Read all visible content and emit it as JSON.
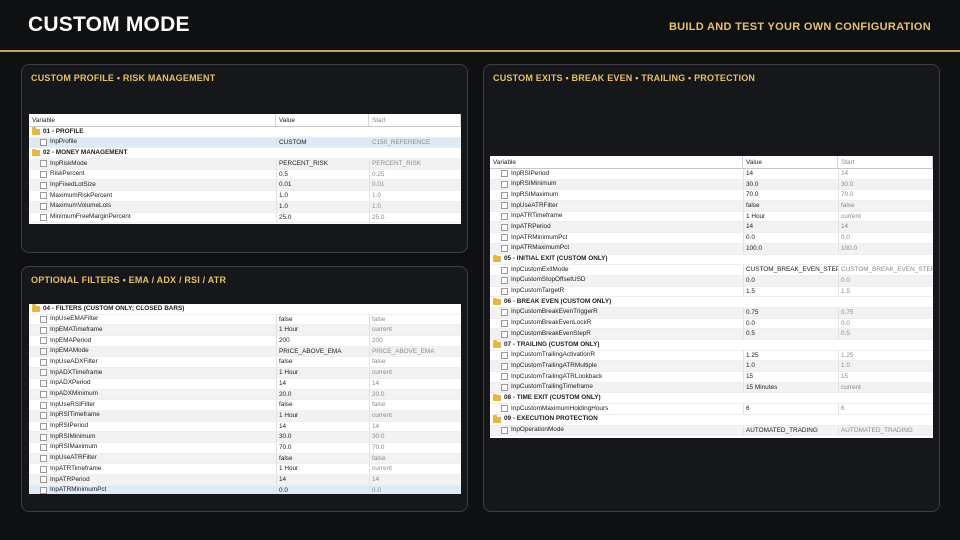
{
  "header": {
    "title": "CUSTOM MODE",
    "subtitle": "BUILD AND TEST YOUR OWN CONFIGURATION"
  },
  "columns": {
    "variable": "Variable",
    "value": "Value",
    "start": "Start"
  },
  "profile_panel": {
    "title": "CUSTOM PROFILE • RISK MANAGEMENT",
    "items": [
      {
        "type": "group",
        "label": "01 - PROFILE"
      },
      {
        "type": "param",
        "name": "InpProfile",
        "value": "CUSTOM",
        "start": "C150_REFERENCE",
        "selected": true
      },
      {
        "type": "group",
        "label": "02 - MONEY MANAGEMENT"
      },
      {
        "type": "param",
        "name": "InpRiskMode",
        "value": "PERCENT_RISK",
        "start": "PERCENT_RISK"
      },
      {
        "type": "param",
        "name": "RiskPercent",
        "value": "0.5",
        "start": "0.25"
      },
      {
        "type": "param",
        "name": "InpFixedLotSize",
        "value": "0.01",
        "start": "0.01"
      },
      {
        "type": "param",
        "name": "MaximumRiskPercent",
        "value": "1.0",
        "start": "1.0"
      },
      {
        "type": "param",
        "name": "MaximumVolumeLots",
        "value": "1.0",
        "start": "1.0"
      },
      {
        "type": "param",
        "name": "MinimumFreeMarginPercent",
        "value": "25.0",
        "start": "25.0"
      }
    ]
  },
  "filters_panel": {
    "title": "OPTIONAL FILTERS • EMA / ADX / RSI / ATR",
    "items": [
      {
        "type": "group",
        "label": "04 - FILTERS (CUSTOM ONLY; CLOSED BARS)"
      },
      {
        "type": "param",
        "name": "InpUseEMAFilter",
        "value": "false",
        "start": "false"
      },
      {
        "type": "param",
        "name": "InpEMATimeframe",
        "value": "1 Hour",
        "start": "current"
      },
      {
        "type": "param",
        "name": "InpEMAPeriod",
        "value": "200",
        "start": "200"
      },
      {
        "type": "param",
        "name": "InpEMAMode",
        "value": "PRICE_ABOVE_EMA",
        "start": "PRICE_ABOVE_EMA"
      },
      {
        "type": "param",
        "name": "InpUseADXFilter",
        "value": "false",
        "start": "false"
      },
      {
        "type": "param",
        "name": "InpADXTimeframe",
        "value": "1 Hour",
        "start": "current"
      },
      {
        "type": "param",
        "name": "InpADXPeriod",
        "value": "14",
        "start": "14"
      },
      {
        "type": "param",
        "name": "InpADXMinimum",
        "value": "20.0",
        "start": "20.0"
      },
      {
        "type": "param",
        "name": "InpUseRSIFilter",
        "value": "false",
        "start": "false"
      },
      {
        "type": "param",
        "name": "InpRSITimeframe",
        "value": "1 Hour",
        "start": "current"
      },
      {
        "type": "param",
        "name": "InpRSIPeriod",
        "value": "14",
        "start": "14"
      },
      {
        "type": "param",
        "name": "InpRSIMinimum",
        "value": "30.0",
        "start": "30.0"
      },
      {
        "type": "param",
        "name": "InpRSIMaximum",
        "value": "70.0",
        "start": "70.0"
      },
      {
        "type": "param",
        "name": "InpUseATRFilter",
        "value": "false",
        "start": "false"
      },
      {
        "type": "param",
        "name": "InpATRTimeframe",
        "value": "1 Hour",
        "start": "current"
      },
      {
        "type": "param",
        "name": "InpATRPeriod",
        "value": "14",
        "start": "14"
      },
      {
        "type": "param",
        "name": "InpATRMinimumPct",
        "value": "0.0",
        "start": "0.0",
        "selected": true
      }
    ]
  },
  "exits_panel": {
    "title": "CUSTOM EXITS • BREAK EVEN • TRAILING • PROTECTION",
    "items": [
      {
        "type": "param",
        "name": "InpRSIPeriod",
        "value": "14",
        "start": "14"
      },
      {
        "type": "param",
        "name": "InpRSIMinimum",
        "value": "30.0",
        "start": "30.0"
      },
      {
        "type": "param",
        "name": "InpRSIMaximum",
        "value": "70.0",
        "start": "70.0"
      },
      {
        "type": "param",
        "name": "InpUseATRFilter",
        "value": "false",
        "start": "false"
      },
      {
        "type": "param",
        "name": "InpATRTimeframe",
        "value": "1 Hour",
        "start": "current"
      },
      {
        "type": "param",
        "name": "InpATRPeriod",
        "value": "14",
        "start": "14"
      },
      {
        "type": "param",
        "name": "InpATRMinimumPct",
        "value": "0.0",
        "start": "0.0"
      },
      {
        "type": "param",
        "name": "InpATRMaximumPct",
        "value": "100.0",
        "start": "100.0"
      },
      {
        "type": "group",
        "label": "05 - INITIAL EXIT (CUSTOM ONLY)"
      },
      {
        "type": "param",
        "name": "InpCustomExitMode",
        "value": "CUSTOM_BREAK_EVEN_STEP",
        "start": "CUSTOM_BREAK_EVEN_STEP"
      },
      {
        "type": "param",
        "name": "InpCustomStopOffsetUSD",
        "value": "0.0",
        "start": "0.0"
      },
      {
        "type": "param",
        "name": "InpCustomTargetR",
        "value": "1.5",
        "start": "1.5"
      },
      {
        "type": "group",
        "label": "06 - BREAK EVEN (CUSTOM ONLY)"
      },
      {
        "type": "param",
        "name": "InpCustomBreakEvenTriggerR",
        "value": "0.75",
        "start": "0.75"
      },
      {
        "type": "param",
        "name": "InpCustomBreakEvenLockR",
        "value": "0.0",
        "start": "0.0"
      },
      {
        "type": "param",
        "name": "InpCustomBreakEvenStepR",
        "value": "0.5",
        "start": "0.5"
      },
      {
        "type": "group",
        "label": "07 - TRAILING (CUSTOM ONLY)"
      },
      {
        "type": "param",
        "name": "InpCustomTrailingActivationR",
        "value": "1.25",
        "start": "1.25"
      },
      {
        "type": "param",
        "name": "InpCustomTrailingATRMultiple",
        "value": "1.0",
        "start": "1.0"
      },
      {
        "type": "param",
        "name": "InpCustomTrailingATRLookback",
        "value": "15",
        "start": "15"
      },
      {
        "type": "param",
        "name": "InpCustomTrailingTimeframe",
        "value": "15 Minutes",
        "start": "current"
      },
      {
        "type": "group",
        "label": "08 - TIME EXIT (CUSTOM ONLY)"
      },
      {
        "type": "param",
        "name": "InpCustomMaximumHoldingHours",
        "value": "6",
        "start": "6"
      },
      {
        "type": "group",
        "label": "09 - EXECUTION PROTECTION"
      },
      {
        "type": "param",
        "name": "InpOperationMode",
        "value": "AUTOMATED_TRADING",
        "start": "AUTOMATED_TRADING"
      }
    ]
  },
  "colors": {
    "accent": "#c9a64f",
    "accent_text": "#e6c162",
    "background": "#0f1011",
    "panel": "#15171a",
    "folder": "#e8b73a",
    "selected_row": "#dfeaf7"
  },
  "icons": {
    "group": "folder-icon",
    "param": "parameter-icon"
  }
}
